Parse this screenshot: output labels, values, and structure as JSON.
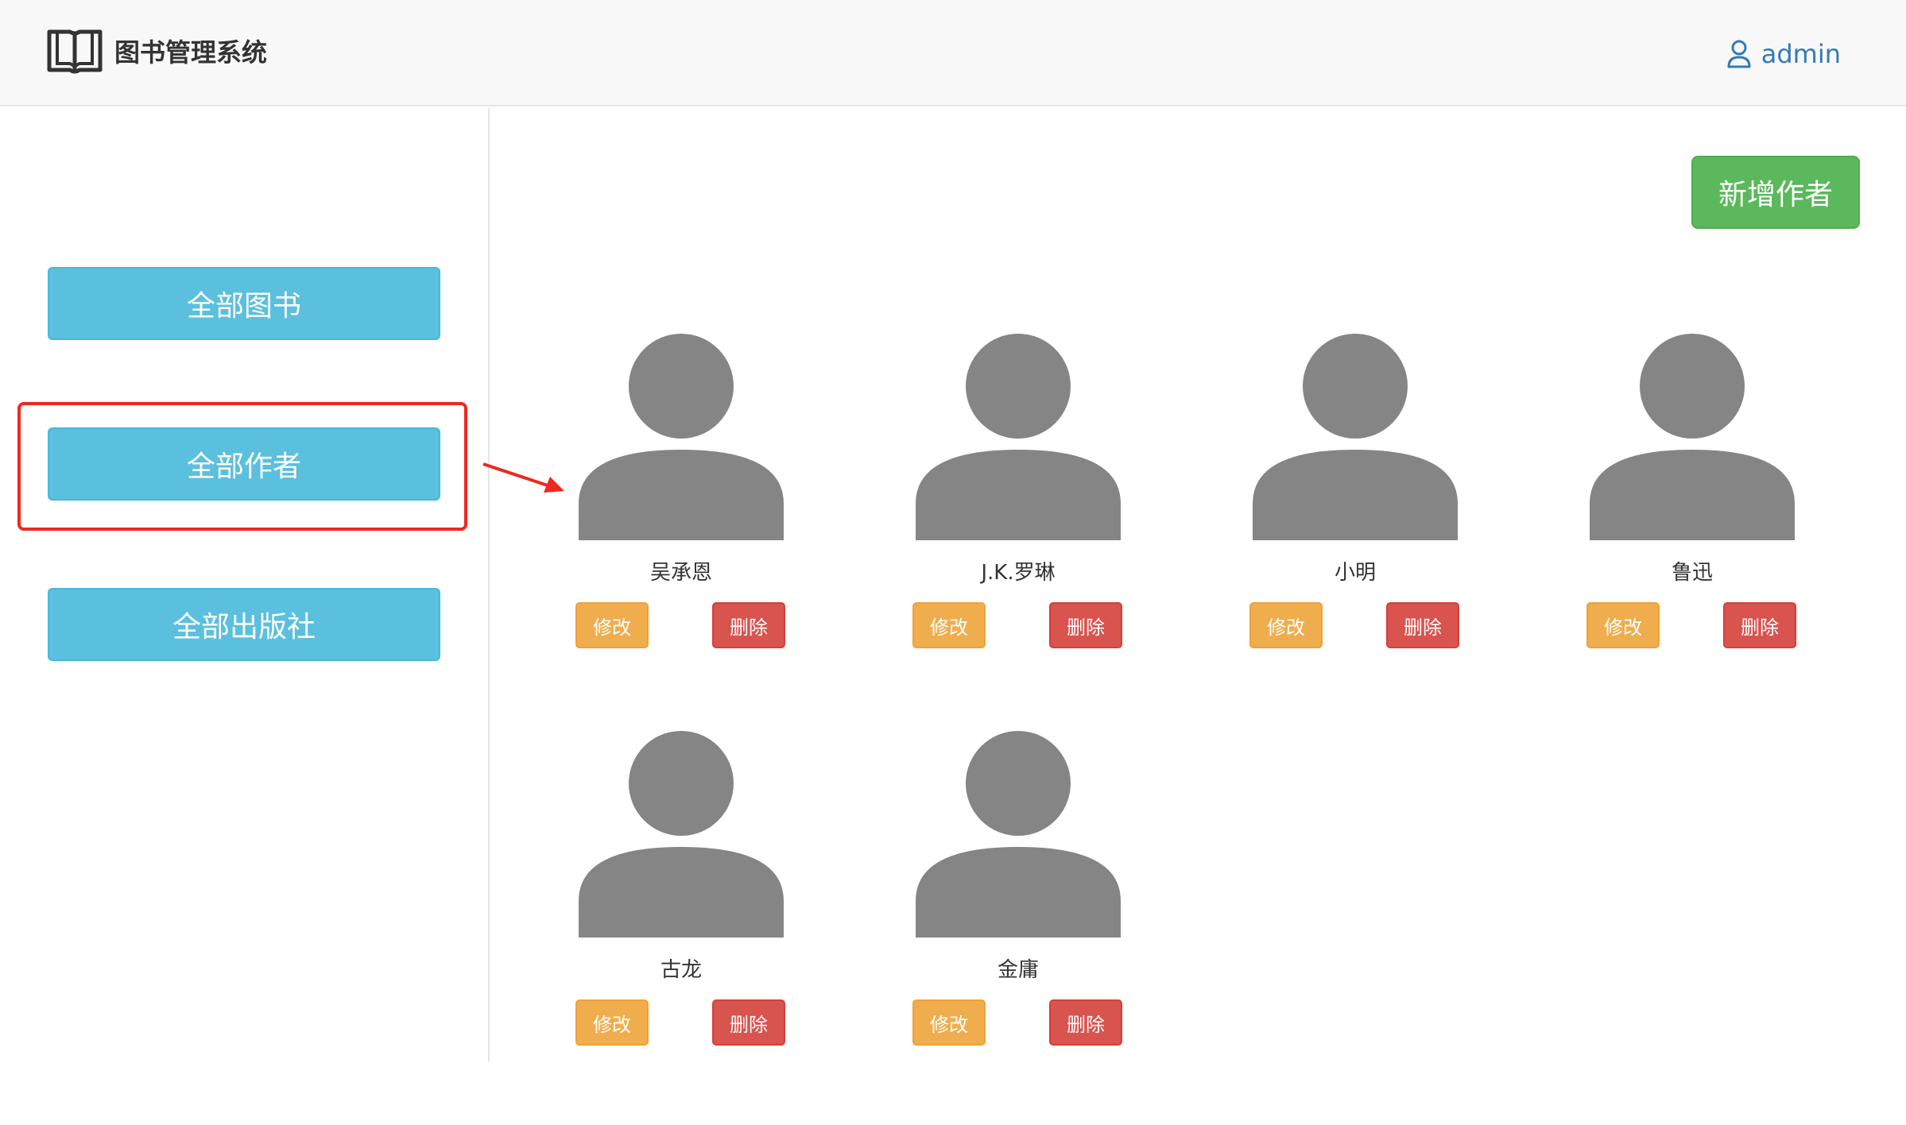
{
  "header": {
    "title": "图书管理系统",
    "user": "admin",
    "icon": "open-book-icon",
    "user_icon": "user-icon"
  },
  "sidebar": {
    "items": [
      {
        "label": "全部图书",
        "key": "books"
      },
      {
        "label": "全部作者",
        "key": "authors"
      },
      {
        "label": "全部出版社",
        "key": "publishers"
      }
    ]
  },
  "main": {
    "add_label": "新增作者",
    "authors": [
      {
        "name": "吴承恩",
        "edit_label": "修改",
        "delete_label": "删除"
      },
      {
        "name": "J.K.罗琳",
        "edit_label": "修改",
        "delete_label": "删除"
      },
      {
        "name": "小明",
        "edit_label": "修改",
        "delete_label": "删除"
      },
      {
        "name": "鲁迅",
        "edit_label": "修改",
        "delete_label": "删除"
      },
      {
        "name": "古龙",
        "edit_label": "修改",
        "delete_label": "删除"
      },
      {
        "name": "金庸",
        "edit_label": "修改",
        "delete_label": "删除"
      }
    ]
  },
  "colors": {
    "info": "#5bc0de",
    "success": "#5cb85c",
    "warning": "#f0ad4e",
    "danger": "#d9534f",
    "annotation": "#f0281e"
  }
}
